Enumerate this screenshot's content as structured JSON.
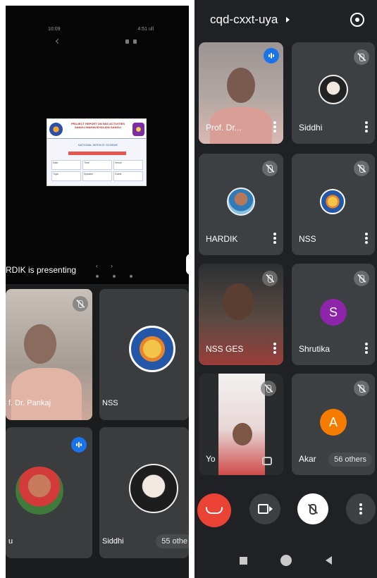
{
  "left_pane": {
    "status_time": "10:09",
    "status_right": "4:51 ull",
    "slide": {
      "header_text": "PROJECT REPORT ON NSS ACTIVITIES SANGLI MAHAVIDYALAYA SANGLI",
      "sub_text": "NATIONAL SERVICE SCHEME",
      "cells": [
        "Date",
        "Time",
        "Venue",
        "Topic",
        "Speaker",
        "Guest"
      ]
    },
    "presenting_label": "RDIK is presenting",
    "tiles": [
      {
        "name": "f. Dr. Pankaj"
      },
      {
        "name": "NSS"
      },
      {
        "name": "u"
      },
      {
        "name": "Siddhi"
      }
    ],
    "others_label": "55 othe"
  },
  "right_pane": {
    "meeting_code": "cqd-cxxt-uya",
    "tiles": [
      {
        "name": "Prof. Dr..."
      },
      {
        "name": "Siddhi"
      },
      {
        "name": "HARDIK"
      },
      {
        "name": "NSS"
      },
      {
        "name": "NSS GES"
      },
      {
        "name": "Shrutika",
        "initial": "S"
      },
      {
        "name": "Yo"
      },
      {
        "name": "Akar",
        "initial": "A"
      }
    ],
    "others_label": "56 others",
    "colors": {
      "background": "#202124",
      "tile": "#3c4043",
      "end_call": "#ea4335",
      "speaking": "#1a73e8",
      "avatar_s": "#8e24aa",
      "avatar_a": "#f57c00"
    },
    "controls": [
      "end-call-icon",
      "camera-icon",
      "mic-off-icon",
      "more-vert-icon"
    ],
    "navbar": [
      "recents-icon",
      "home-icon",
      "back-icon"
    ]
  }
}
